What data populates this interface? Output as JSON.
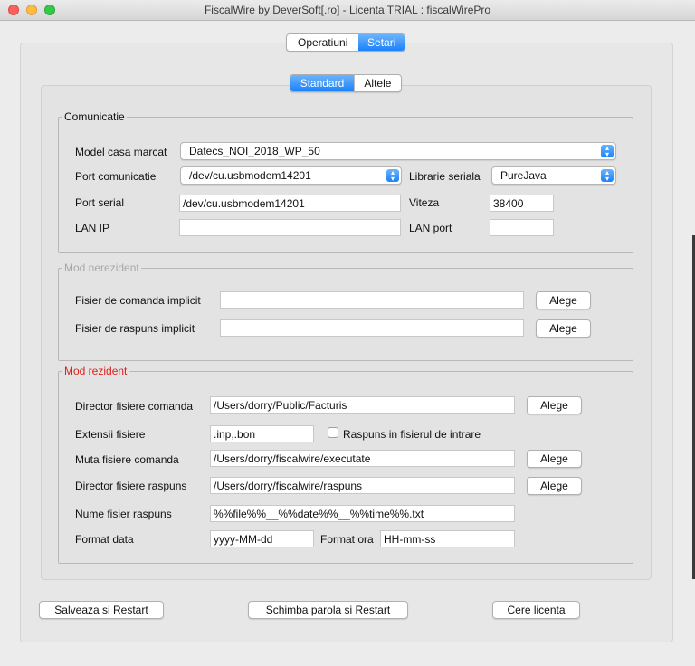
{
  "window": {
    "title": "FiscalWire by DeverSoft[.ro] - Licenta TRIAL : fiscalWirePro"
  },
  "main_tabs": [
    {
      "label": "Operatiuni",
      "selected": false
    },
    {
      "label": "Setari",
      "selected": true
    }
  ],
  "sub_tabs": [
    {
      "label": "Standard",
      "selected": true
    },
    {
      "label": "Altele",
      "selected": false
    }
  ],
  "comunicatie": {
    "legend": "Comunicatie",
    "model_label": "Model casa marcat",
    "model_value": "Datecs_NOI_2018_WP_50",
    "port_label": "Port comunicatie",
    "port_value": "/dev/cu.usbmodem14201",
    "lib_label": "Librarie seriala",
    "lib_value": "PureJava",
    "serial_label": "Port serial",
    "serial_value": "/dev/cu.usbmodem14201",
    "viteza_label": "Viteza",
    "viteza_value": "38400",
    "lanip_label": "LAN IP",
    "lanip_value": "",
    "lanport_label": "LAN port",
    "lanport_value": ""
  },
  "nerezident": {
    "legend": "Mod nerezident",
    "cmd_label": "Fisier de comanda implicit",
    "cmd_value": "",
    "resp_label": "Fisier de raspuns implicit",
    "resp_value": "",
    "choose_label": "Alege"
  },
  "rezident": {
    "legend": "Mod rezident",
    "legend_color": "#e0201b",
    "dir_cmd_label": "Director fisiere comanda",
    "dir_cmd_value": "/Users/dorry/Public/Facturis",
    "ext_label": "Extensii fisiere",
    "ext_value": ".inp,.bon",
    "raspuns_check_label": "Raspuns in fisierul de intrare",
    "raspuns_checked": false,
    "muta_label": "Muta fisiere comanda",
    "muta_value": "/Users/dorry/fiscalwire/executate",
    "dir_resp_label": "Director fisiere raspuns",
    "dir_resp_value": "/Users/dorry/fiscalwire/raspuns",
    "nume_label": "Nume fisier raspuns",
    "nume_value": "%%file%%__%%date%%__%%time%%.txt",
    "format_data_label": "Format data",
    "format_data_value": "yyyy-MM-dd",
    "format_ora_label": "Format ora",
    "format_ora_value": "HH-mm-ss",
    "choose_label": "Alege"
  },
  "footer": {
    "save_label": "Salveaza si Restart",
    "password_label": "Schimba parola si Restart",
    "license_label": "Cere licenta"
  },
  "colors": {
    "accent": "#1a82fb",
    "disabled_legend": "#a8a8a8"
  }
}
